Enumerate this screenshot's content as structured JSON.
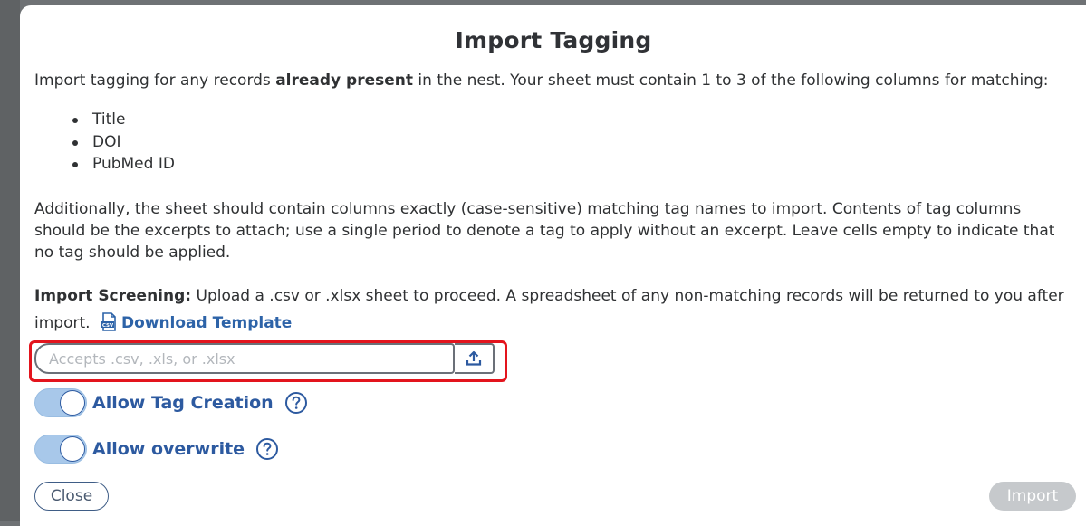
{
  "modal": {
    "title": "Import Tagging",
    "intro": {
      "prefix": "Import tagging for any records ",
      "emphasis": "already present",
      "suffix": " in the nest. Your sheet must contain 1 to 3 of the following columns for matching:"
    },
    "columns": [
      "Title",
      "DOI",
      "PubMed ID"
    ],
    "additional": "Additionally, the sheet should contain columns exactly (case-sensitive) matching tag names to import. Contents of tag columns should be the excerpts to attach; use a single period to denote a tag to apply without an excerpt. Leave cells empty to indicate that no tag should be applied.",
    "screening": {
      "label": "Import Screening:",
      "text": " Upload a .csv or .xlsx sheet to proceed. A spreadsheet of any non-matching records will be returned to you after import.",
      "download_icon": "csv-file-icon",
      "download_label": "Download Template"
    },
    "file_input": {
      "placeholder": "Accepts .csv, .xls, or .xlsx",
      "value": "",
      "upload_icon": "upload-icon"
    },
    "toggles": [
      {
        "label": "Allow Tag Creation",
        "on": true,
        "help_icon": "question-circle-icon"
      },
      {
        "label": "Allow overwrite",
        "on": true,
        "help_icon": "question-circle-icon"
      }
    ],
    "buttons": {
      "close": "Close",
      "import": "Import"
    }
  },
  "colors": {
    "accent": "#2d5aa0",
    "link": "#2d63a8",
    "toggle_track": "#a8c8ea",
    "highlight": "#e3141d",
    "disabled_button": "#c6c9cc"
  }
}
